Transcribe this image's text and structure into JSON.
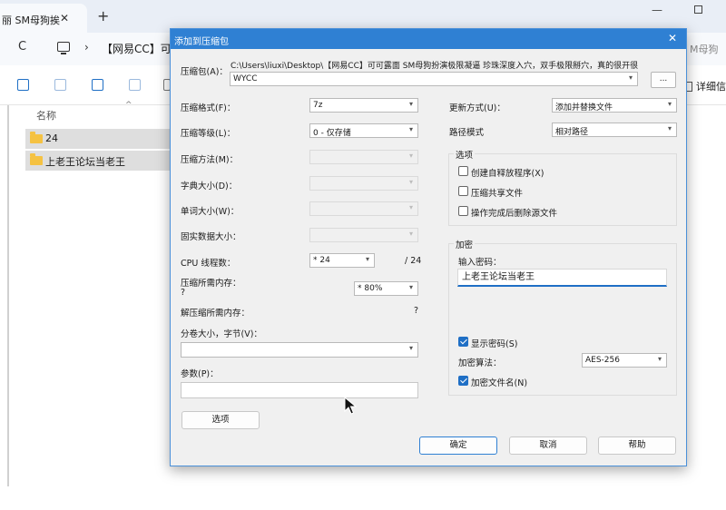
{
  "browser": {
    "tab_title": "丽 SM母狗挨",
    "tab_close": "✕",
    "new_tab": "+",
    "minimize": "—"
  },
  "address": {
    "refresh": "C",
    "separator": "›",
    "breadcrumb": "【网易CC】可",
    "search_hint": "M母狗"
  },
  "toolbar": {
    "details_label": "详细信"
  },
  "file_list": {
    "column_name": "名称",
    "sort_indicator": "^",
    "items": [
      {
        "name": "24"
      },
      {
        "name": "上老王论坛当老王"
      }
    ]
  },
  "dialog": {
    "title": "添加到压缩包",
    "close": "✕",
    "archive_label": "压缩包(A)：",
    "archive_path": "C:\\Users\\liuxi\\Desktop\\【网易CC】可可露面 SM母狗扮演极限凝逼 珍珠深度入穴，双手极限掰穴，真的很开很",
    "archive_name": "WYCC",
    "browse_label": "...",
    "left": {
      "format_label": "压缩格式(F)：",
      "format_value": "7z",
      "level_label": "压缩等级(L)：",
      "level_value": "0 - 仅存储",
      "method_label": "压缩方法(M)：",
      "dict_label": "字典大小(D)：",
      "word_label": "单词大小(W)：",
      "solid_label": "固实数据大小：",
      "cpu_label": "CPU 线程数：",
      "cpu_value": "* 24",
      "cpu_total": "/ 24",
      "mem_label": "压缩所需内存：",
      "mem_question": "?",
      "mem_value": "* 80%",
      "decomp_label": "解压缩所需内存：",
      "decomp_value": "?",
      "volume_label": "分卷大小，字节(V)：",
      "params_label": "参数(P)：",
      "options_button": "选项"
    },
    "right": {
      "update_label": "更新方式(U)：",
      "update_value": "添加并替换文件",
      "path_label": "路径模式",
      "path_value": "相对路径",
      "options_group": "选项",
      "opt_sfx": "创建自释放程序(X)",
      "opt_shared": "压缩共享文件",
      "opt_delete": "操作完成后删除源文件",
      "encrypt_group": "加密",
      "password_label": "输入密码：",
      "password_value": "上老王论坛当老王",
      "show_password": "显示密码(S)",
      "algo_label": "加密算法：",
      "algo_value": "AES-256",
      "encrypt_names": "加密文件名(N)"
    },
    "buttons": {
      "ok": "确定",
      "cancel": "取消",
      "help": "帮助"
    }
  },
  "colors": {
    "accent": "#2f80d3",
    "folder": "#f5c242"
  }
}
